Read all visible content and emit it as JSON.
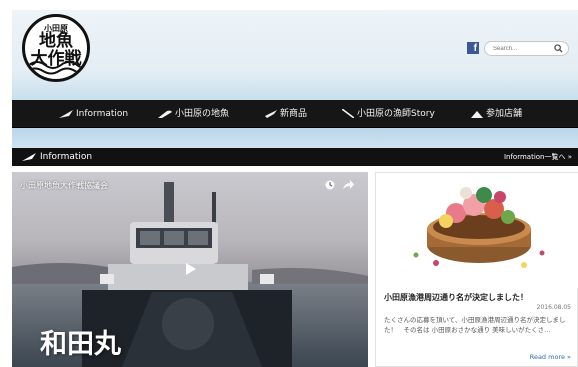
{
  "header": {
    "logo": {
      "line1": "小田原",
      "line2": "地魚",
      "line3": "大作戦"
    },
    "social": {
      "icon": "facebook-icon",
      "label": "f"
    },
    "search": {
      "placeholder": "Search...",
      "icon": "search-icon"
    }
  },
  "nav": {
    "items": [
      {
        "label": "Information",
        "icon": "feather-pen-icon"
      },
      {
        "label": "小田原の地魚",
        "icon": "fish-icon"
      },
      {
        "label": "新商品",
        "icon": "knife-icon"
      },
      {
        "label": "小田原の漁師Story",
        "icon": "fishing-rod-icon"
      },
      {
        "label": "参加店舗",
        "icon": "mountain-icon"
      }
    ]
  },
  "section": {
    "title": "Information",
    "icon": "feather-pen-icon",
    "more_label": "Information一覧へ »"
  },
  "video": {
    "title": "小田原地魚大作戦協議会",
    "boat_name": "和田丸",
    "icons": [
      "clock-icon",
      "share-icon",
      "play-icon"
    ]
  },
  "card": {
    "title": "小田原漁港周辺通り名が決定しました！",
    "date": "2016.08.05",
    "excerpt": "たくさんの応募を頂いて、小田原漁港周辺通り名が決定しました！　その名は 小田原おさかな通り 美味しいがたくさ…",
    "more_label": "Read more »"
  },
  "colors": {
    "nav_bg": "#161616",
    "section_bg": "#111111",
    "link": "#2b6cb0",
    "facebook": "#3b5998"
  }
}
